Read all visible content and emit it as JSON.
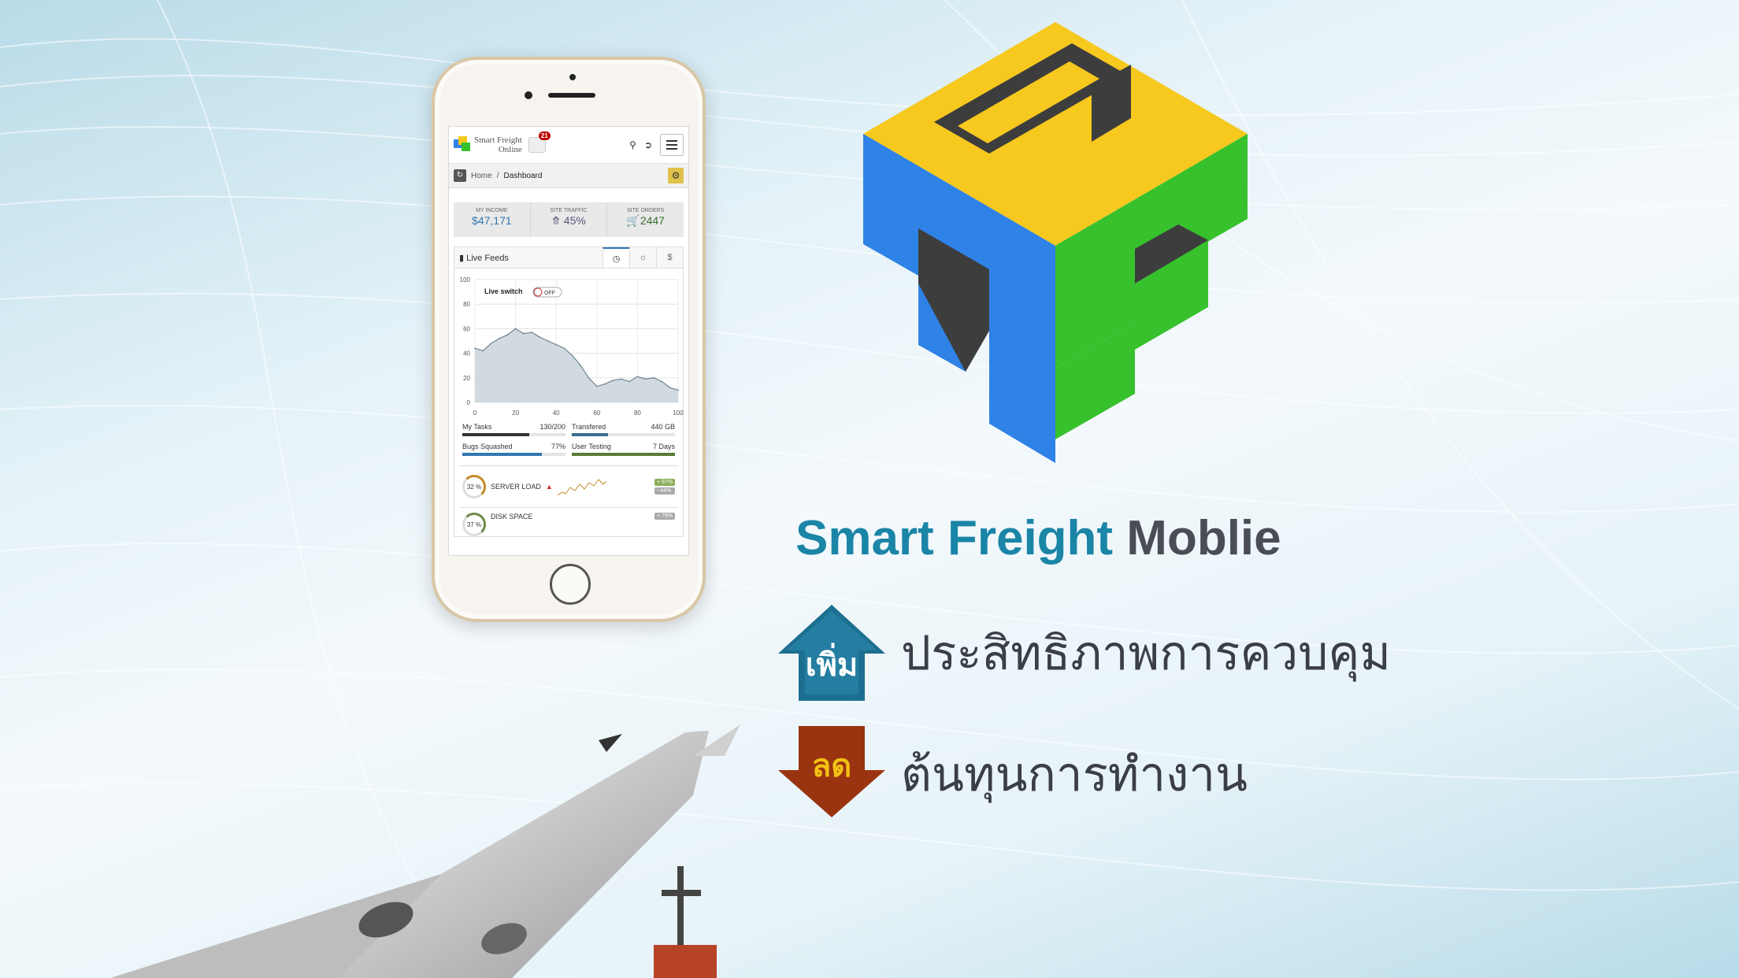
{
  "app": {
    "brand_line1": "Smart Freight",
    "brand_line2": "Online",
    "notification_count": "21",
    "breadcrumb": [
      "Home",
      "Dashboard"
    ]
  },
  "stats": [
    {
      "label": "MY INCOME",
      "value": "$47,171",
      "color": "#3276b1"
    },
    {
      "label": "SITE TRAFFIC",
      "value": "45%",
      "icon": "arrow-circle-up-icon",
      "color": "#5b4f7a"
    },
    {
      "label": "SITE ORDERS",
      "value": "2447",
      "icon": "cart-icon",
      "color": "#3a6e2e"
    }
  ],
  "widget": {
    "title": "Live Feeds",
    "tabs": [
      "clock-icon",
      "traffic-icon",
      "$"
    ],
    "live_switch_label": "Live switch",
    "switch_state": "OFF"
  },
  "chart_data": {
    "type": "area",
    "title": "",
    "xlabel": "",
    "ylabel": "",
    "xlim": [
      0,
      100
    ],
    "ylim": [
      0,
      100
    ],
    "x_ticks": [
      0,
      20,
      40,
      60,
      80,
      100
    ],
    "y_ticks": [
      0,
      20,
      40,
      60,
      80,
      100
    ],
    "grid": true,
    "x": [
      0,
      4,
      8,
      12,
      16,
      20,
      24,
      28,
      32,
      36,
      40,
      44,
      48,
      52,
      56,
      60,
      64,
      68,
      72,
      76,
      80,
      84,
      88,
      92,
      96,
      100
    ],
    "values": [
      44,
      42,
      48,
      52,
      55,
      60,
      56,
      57,
      53,
      50,
      47,
      44,
      38,
      30,
      20,
      13,
      15,
      18,
      19,
      17,
      21,
      19,
      20,
      17,
      12,
      10
    ],
    "fill_color": "#c8d4da",
    "line_color": "#6f8592"
  },
  "progress": [
    {
      "label": "My Tasks",
      "value_text": "130/200",
      "fraction": 0.65,
      "color": "#333333"
    },
    {
      "label": "Transfered",
      "value_text": "440 GB",
      "fraction": 0.35,
      "color": "#3b6e8f"
    },
    {
      "label": "Bugs Squashed",
      "value_text": "77%",
      "fraction": 0.77,
      "color": "#3276b1"
    },
    {
      "label": "User Testing",
      "value_text": "7 Days",
      "fraction": 1.0,
      "color": "#5a7a3a"
    }
  ],
  "server": {
    "ring_text": "32 %",
    "label": "SERVER LOAD",
    "pct_up": "+ 97%",
    "pct_down": "- 44%",
    "row2_ring_text": "37 %",
    "row2_label": "DISK SPACE",
    "row2_pct": "+ 79%"
  },
  "headline": {
    "part1": "Smart Freight",
    "part2": "Moblie"
  },
  "benefits": [
    {
      "badge": "เพิ่ม",
      "text": "ประสิทธิภาพการควบคุม",
      "direction": "up",
      "color": "#1d6f8f",
      "badge_color": "#ffffff"
    },
    {
      "badge": "ลด",
      "text": "ต้นทุนการทำงาน",
      "direction": "down",
      "color": "#9a3410",
      "badge_color": "#f2c214"
    }
  ],
  "logo": {
    "colors": {
      "yellow": "#f7c81e",
      "blue": "#2f82e6",
      "green": "#37c12d",
      "dark": "#3d3d3d"
    }
  }
}
